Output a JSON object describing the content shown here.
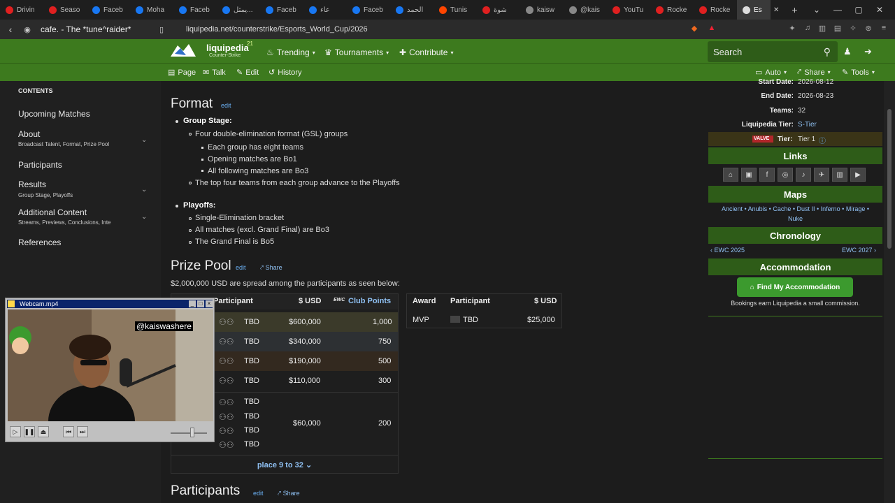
{
  "tabs": [
    {
      "label": "Drivin",
      "color": "#e02020"
    },
    {
      "label": "Seaso",
      "color": "#e02020"
    },
    {
      "label": "Faceb",
      "color": "#1877f2"
    },
    {
      "label": "Moha",
      "color": "#1877f2"
    },
    {
      "label": "Faceb",
      "color": "#1877f2"
    },
    {
      "label": "يمثل...",
      "color": "#1877f2"
    },
    {
      "label": "Faceb",
      "color": "#1877f2"
    },
    {
      "label": "عاء",
      "color": "#1877f2"
    },
    {
      "label": "Faceb",
      "color": "#1877f2"
    },
    {
      "label": "الحمد",
      "color": "#1877f2"
    },
    {
      "label": "Tunis",
      "color": "#ff4500"
    },
    {
      "label": "شوة",
      "color": "#e02020"
    },
    {
      "label": "kaisw",
      "color": "#888"
    },
    {
      "label": "@kais",
      "color": "#888"
    },
    {
      "label": "YouTu",
      "color": "#e02020"
    },
    {
      "label": "Rocke",
      "color": "#e02020"
    },
    {
      "label": "Rocke",
      "color": "#e02020"
    }
  ],
  "active_tab": "Es",
  "window": {
    "page_title": "cafe. - The *tune^raider*",
    "url": "liquipedia.net/counterstrike/Esports_World_Cup/2026"
  },
  "site": {
    "name": "liquipedia",
    "sub": "Counter-Strike",
    "ver": "21"
  },
  "topnav": {
    "trending": "Trending",
    "tournaments": "Tournaments",
    "contribute": "Contribute",
    "search": "Search"
  },
  "subnav": {
    "page": "Page",
    "talk": "Talk",
    "edit": "Edit",
    "history": "History",
    "auto": "Auto",
    "share": "Share",
    "tools": "Tools"
  },
  "sidebar": {
    "contents": "CONTENTS",
    "items": [
      {
        "label": "Upcoming Matches",
        "sub": ""
      },
      {
        "label": "About",
        "sub": "Broadcast Talent, Format, Prize Pool"
      },
      {
        "label": "Participants",
        "sub": ""
      },
      {
        "label": "Results",
        "sub": "Group Stage, Playoffs"
      },
      {
        "label": "Additional Content",
        "sub": "Streams, Previews, Conclusions, Inte"
      },
      {
        "label": "References",
        "sub": ""
      }
    ]
  },
  "format": {
    "heading": "Format",
    "edit": "edit",
    "group_stage": "Group Stage:",
    "gs_lines": [
      "Four double-elimination format (GSL) groups",
      "Each group has eight teams",
      "Opening matches are Bo1",
      "All following matches are Bo3",
      "The top four teams from each group advance to the Playoffs"
    ],
    "playoffs": "Playoffs:",
    "po_lines": [
      "Single-Elimination bracket",
      "All matches (excl. Grand Final) are Bo3",
      "The Grand Final is Bo5"
    ]
  },
  "prize": {
    "heading": "Prize Pool",
    "edit": "edit",
    "share": "Share",
    "intro": "$2,000,000 USD are spread among the participants as seen below:",
    "cols": {
      "participant": "Participant",
      "usd": "$ USD",
      "pts": "Club Points",
      "ewc": "EWC"
    },
    "rows": [
      {
        "team": "TBD",
        "usd": "$600,000",
        "pts": "1,000"
      },
      {
        "team": "TBD",
        "usd": "$340,000",
        "pts": "750"
      },
      {
        "team": "TBD",
        "usd": "$190,000",
        "pts": "500"
      },
      {
        "team": "TBD",
        "usd": "$110,000",
        "pts": "300"
      },
      {
        "team": "TBD",
        "usd": "$60,000",
        "pts": "200"
      }
    ],
    "extra_teams": [
      "TBD",
      "TBD",
      "TBD"
    ],
    "more": "place 9 to 32"
  },
  "award": {
    "cols": {
      "award": "Award",
      "participant": "Participant",
      "usd": "$ USD"
    },
    "row": {
      "award": "MVP",
      "participant": "TBD",
      "usd": "$25,000"
    }
  },
  "participants": {
    "heading": "Participants",
    "edit": "edit",
    "share": "Share"
  },
  "infobox": {
    "start_label": "Start Date:",
    "start": "2026-08-12",
    "end_label": "End Date:",
    "end": "2026-08-23",
    "teams_label": "Teams:",
    "teams": "32",
    "tier_label": "Liquipedia Tier:",
    "tier": "S-Tier",
    "valve_label": "VALVE",
    "valve_tier_label": "Tier:",
    "valve_tier": "Tier 1",
    "links": "Links",
    "maps": "Maps",
    "map_line1": "Ancient • Anubis • Cache • Dust II • Inferno • Mirage •",
    "map_line2": "Nuke",
    "chronology": "Chronology",
    "prev": "EWC 2025",
    "next": "EWC 2027",
    "accommodation": "Accommodation",
    "find": "Find My Accommodation",
    "earn": "Bookings earn Liquipedia a small commission."
  },
  "webcam": {
    "title": "Webcam.mp4",
    "overlay": "@kaiswashere"
  }
}
